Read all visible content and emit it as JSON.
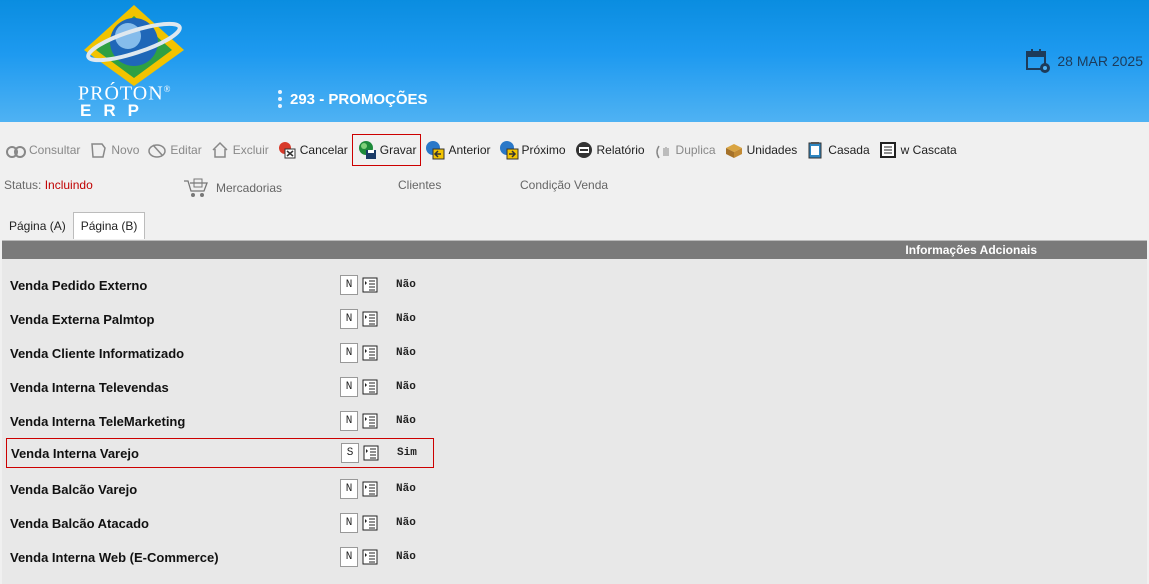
{
  "header": {
    "brand_name": "PRÓTON",
    "brand_reg": "®",
    "brand_sub": "ERP",
    "module_title": "293 - PROMOÇÕES",
    "date": "28 MAR 2025"
  },
  "toolbar": {
    "consultar": "Consultar",
    "novo": "Novo",
    "editar": "Editar",
    "excluir": "Excluir",
    "cancelar": "Cancelar",
    "gravar": "Gravar",
    "anterior": "Anterior",
    "proximo": "Próximo",
    "relatorio": "Relatório",
    "duplica": "Duplica",
    "unidades": "Unidades",
    "casada": "Casada",
    "cascata": "w Cascata"
  },
  "status": {
    "label": "Status:",
    "value": "Incluindo"
  },
  "links": {
    "mercadorias": "Mercadorias",
    "clientes": "Clientes",
    "condicao_venda": "Condição Venda"
  },
  "tabs": [
    {
      "label": "Página (A)",
      "active": false
    },
    {
      "label": "Página (B)",
      "active": true
    }
  ],
  "panel": {
    "title": "Informações Adcionais",
    "rows": [
      {
        "label": "Venda Pedido Externo",
        "code": "N",
        "value": "Não"
      },
      {
        "label": "Venda Externa Palmtop",
        "code": "N",
        "value": "Não"
      },
      {
        "label": "Venda Cliente Informatizado",
        "code": "N",
        "value": "Não"
      },
      {
        "label": "Venda Interna Televendas",
        "code": "N",
        "value": "Não"
      },
      {
        "label": "Venda Interna TeleMarketing",
        "code": "N",
        "value": "Não"
      },
      {
        "label": "Venda Interna Varejo",
        "code": "S",
        "value": "Sim"
      },
      {
        "label": "Venda Balcão Varejo",
        "code": "N",
        "value": "Não"
      },
      {
        "label": "Venda Balcão Atacado",
        "code": "N",
        "value": "Não"
      },
      {
        "label": "Venda Interna Web (E-Commerce)",
        "code": "N",
        "value": "Não"
      }
    ]
  },
  "colors": {
    "header_blue": "#1e9af0",
    "status_red": "#c00000",
    "highlight_red": "#cc0000",
    "panel_header_gray": "#7a7a7a"
  }
}
